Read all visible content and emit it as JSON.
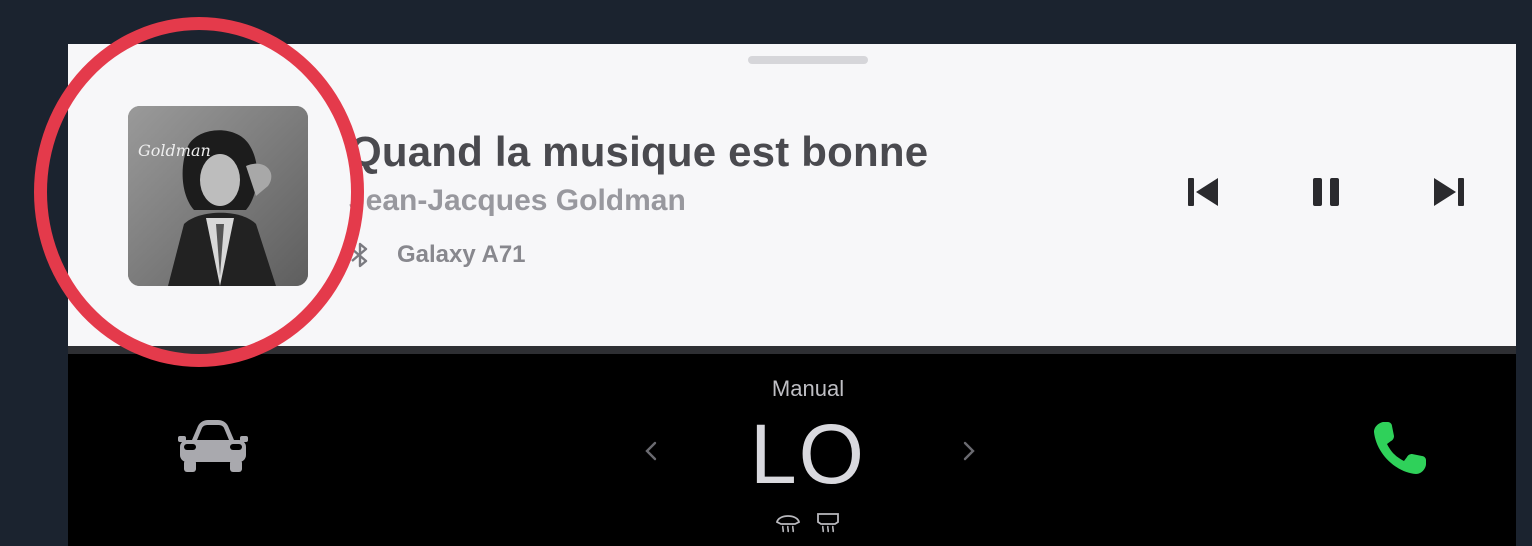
{
  "media": {
    "track_title": "Quand la musique est bonne",
    "artist": "Jean-Jacques Goldman",
    "source_device": "Galaxy A71",
    "source_icon": "bluetooth-icon",
    "album_art_icon": "album-art"
  },
  "controls": {
    "previous_icon": "skip-previous-icon",
    "pause_icon": "pause-icon",
    "next_icon": "skip-next-icon"
  },
  "climate": {
    "mode": "Manual",
    "temperature": "LO",
    "left_arrow_icon": "chevron-left-icon",
    "right_arrow_icon": "chevron-right-icon",
    "defrost_icons": [
      "front-defrost-icon",
      "rear-defrost-icon"
    ]
  },
  "bottom_bar": {
    "car_icon": "car-icon",
    "phone_icon": "phone-icon"
  },
  "colors": {
    "page_background": "#1b232f",
    "card_background": "#f7f7f9",
    "bar_background": "#000000",
    "phone_green": "#2fd15a",
    "highlight_red": "#e43a4b"
  }
}
